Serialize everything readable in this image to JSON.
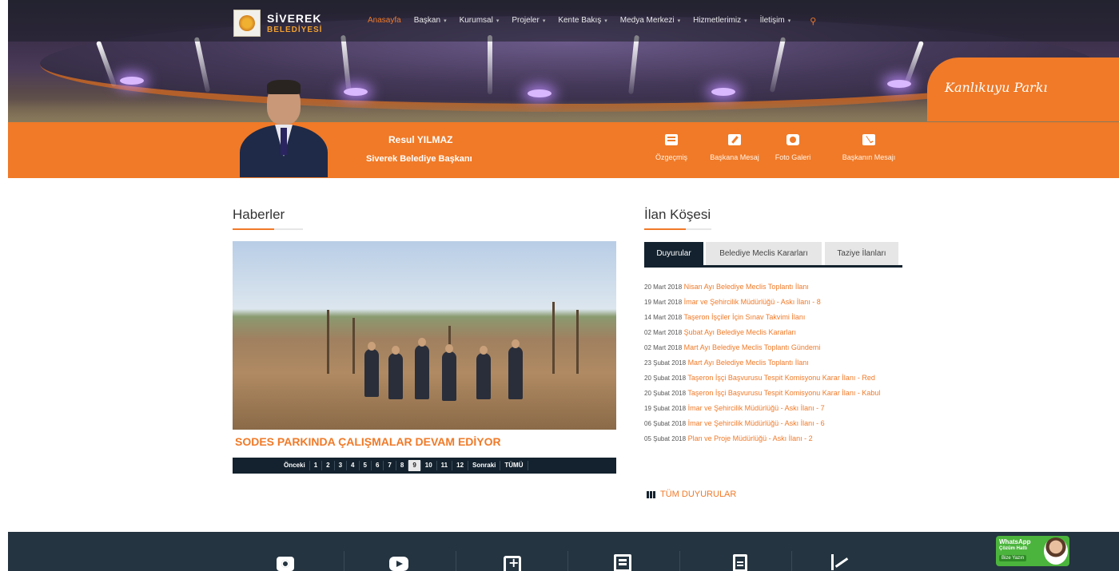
{
  "header": {
    "logo": {
      "line1": "SİVEREK",
      "line2": "BELEDİYESİ"
    },
    "nav": [
      {
        "label": "Anasayfa",
        "active": true,
        "dropdown": false
      },
      {
        "label": "Başkan",
        "dropdown": true
      },
      {
        "label": "Kurumsal",
        "dropdown": true
      },
      {
        "label": "Projeler",
        "dropdown": true
      },
      {
        "label": "Kente Bakış",
        "dropdown": true
      },
      {
        "label": "Medya Merkezi",
        "dropdown": true
      },
      {
        "label": "Hizmetlerimiz",
        "dropdown": true
      },
      {
        "label": "İletişim",
        "dropdown": true
      }
    ],
    "search_icon": "search-icon",
    "hero_caption": "Kanlıkuyu Parkı"
  },
  "mayor": {
    "name": "Resul YILMAZ",
    "title": "Siverek Belediye Başkanı",
    "links": [
      {
        "label": "Özgeçmiş",
        "icon": "book-icon"
      },
      {
        "label": "Başkana Mesaj",
        "icon": "pencil-icon"
      },
      {
        "label": "Foto Galeri",
        "icon": "camera-icon"
      },
      {
        "label": "Başkanın Mesajı",
        "icon": "envelope-icon"
      }
    ]
  },
  "news": {
    "section_title": "Haberler",
    "headline": "SODES PARKINDA ÇALIŞMALAR DEVAM EDİYOR",
    "pager": {
      "prev": "Önceki",
      "pages": [
        "1",
        "2",
        "3",
        "4",
        "5",
        "6",
        "7",
        "8",
        "9",
        "10",
        "11",
        "12"
      ],
      "current": "9",
      "next": "Sonraki",
      "all": "TÜMÜ"
    }
  },
  "announcements": {
    "section_title": "İlan Köşesi",
    "tabs": [
      {
        "label": "Duyurular",
        "active": true
      },
      {
        "label": "Belediye Meclis Kararları",
        "active": false
      },
      {
        "label": "Taziye İlanları",
        "active": false
      }
    ],
    "items": [
      {
        "date": "20 Mart 2018",
        "title": "Nisan Ayı Belediye Meclis Toplantı İlanı"
      },
      {
        "date": "19 Mart 2018",
        "title": "İmar ve Şehircilik Müdürlüğü - Askı İlanı - 8"
      },
      {
        "date": "14 Mart 2018",
        "title": "Taşeron İşçiler İçin Sınav Takvimi İlanı"
      },
      {
        "date": "02 Mart 2018",
        "title": "Şubat Ayı Belediye Meclis Kararları"
      },
      {
        "date": "02 Mart 2018",
        "title": "Mart Ayı Belediye Meclis Toplantı Gündemi"
      },
      {
        "date": "23 Şubat 2018",
        "title": "Mart Ayı Belediye Meclis Toplantı İlanı"
      },
      {
        "date": "20 Şubat 2018",
        "title": "Taşeron İşçi Başvurusu Tespit Komisyonu Karar İlanı - Red"
      },
      {
        "date": "20 Şubat 2018",
        "title": "Taşeron İşçi Başvurusu Tespit Komisyonu Karar İlanı - Kabul"
      },
      {
        "date": "19 Şubat 2018",
        "title": "İmar ve Şehircilik Müdürlüğü - Askı İlanı - 7"
      },
      {
        "date": "06 Şubat 2018",
        "title": "İmar ve Şehircilik Müdürlüğü - Askı İlanı - 6"
      },
      {
        "date": "05 Şubat 2018",
        "title": "Plan ve Proje Müdürlüğü - Askı İlanı - 2"
      }
    ],
    "all_link": "TÜM DUYURULAR"
  },
  "footer": {
    "icons": [
      "camera-icon",
      "youtube-icon",
      "medical-kit-icon",
      "newspaper-icon",
      "document-icon",
      "chart-icon"
    ],
    "whatsapp": {
      "line1": "WhatsApp",
      "line2": "Çözüm Hattı",
      "button": "Bize Yazın"
    }
  },
  "colors": {
    "accent": "#f07a28",
    "navy": "#13222e",
    "footer": "#243440",
    "whatsapp": "#4bb43c"
  }
}
